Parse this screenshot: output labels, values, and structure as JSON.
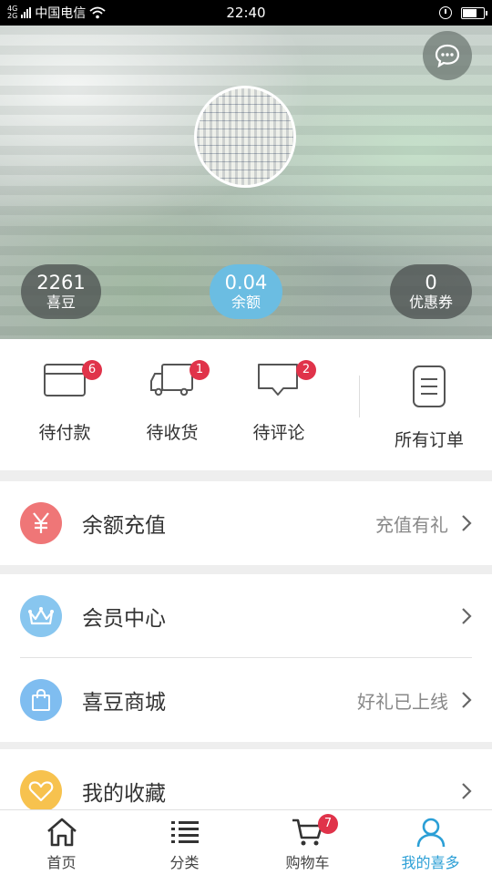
{
  "status_bar": {
    "network": [
      "4G",
      "2G"
    ],
    "carrier": "中国电信",
    "time": "22:40"
  },
  "header": {
    "stats": {
      "beans": {
        "value": "2261",
        "label": "喜豆"
      },
      "balance": {
        "value": "0.04",
        "label": "余额"
      },
      "coupons": {
        "value": "0",
        "label": "优惠券"
      }
    }
  },
  "orders": {
    "items": [
      {
        "label": "待付款",
        "badge": "6",
        "icon": "card-icon"
      },
      {
        "label": "待收货",
        "badge": "1",
        "icon": "truck-icon"
      },
      {
        "label": "待评论",
        "badge": "2",
        "icon": "comment-icon"
      },
      {
        "label": "所有订单",
        "icon": "order-list-icon"
      }
    ]
  },
  "menu": {
    "recharge": {
      "label": "余额充值",
      "hint": "充值有礼",
      "icon": "yen-icon",
      "color": "#ef7677"
    },
    "member": {
      "label": "会员中心",
      "icon": "crown-icon",
      "color": "#88c6ef"
    },
    "mall": {
      "label": "喜豆商城",
      "hint": "好礼已上线",
      "icon": "shopping-bag-icon",
      "color": "#7fbdf0"
    },
    "favorites": {
      "label": "我的收藏",
      "icon": "heart-icon",
      "color": "#f7c24e"
    }
  },
  "bottom_nav": {
    "items": [
      {
        "label": "首页",
        "icon": "home-icon"
      },
      {
        "label": "分类",
        "icon": "category-icon"
      },
      {
        "label": "购物车",
        "icon": "cart-icon",
        "badge": "7"
      },
      {
        "label": "我的喜多",
        "icon": "user-icon",
        "active": true
      }
    ]
  },
  "colors": {
    "accent": "#2b9fd6",
    "badge": "#e0334a",
    "balance_pill": "#6bbde2"
  }
}
